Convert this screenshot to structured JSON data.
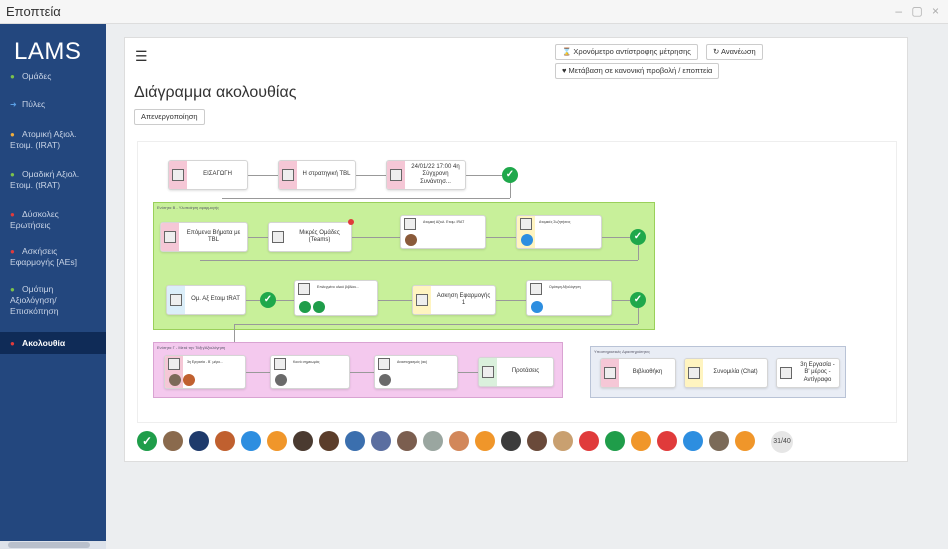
{
  "window": {
    "title": "Εποπτεία",
    "controls": "– ▢ ×"
  },
  "sidebar": {
    "logo": "LAMS",
    "items": [
      {
        "label": "Ομάδες",
        "icon": "group-icon",
        "icon_color": "#7cc24b"
      },
      {
        "label": "Πύλες",
        "icon": "sign-in-icon",
        "icon_color": "#5aa0e6"
      },
      {
        "label": "Ατομική Αξιολ. Ετοιμ. (IRAT)",
        "icon": "user-icon",
        "icon_color": "#f0ad3c"
      },
      {
        "label": "Ομαδική Αξιολ. Ετοιμ. (tRAT)",
        "icon": "users-icon",
        "icon_color": "#7cc24b"
      },
      {
        "label": "Δύσκολες Ερωτήσεις",
        "icon": "alert-icon",
        "icon_color": "#e03b3b"
      },
      {
        "label": "Ασκήσεις Εφαρμογής [AEs]",
        "icon": "cogs-icon",
        "icon_color": "#e03b3b"
      },
      {
        "label": "Ομότιμη Αξιολόγηση/ Επισκόπηση",
        "icon": "users-icon",
        "icon_color": "#7cc24b"
      },
      {
        "label": "Ακολουθία",
        "icon": "sequence-icon",
        "icon_color": "#e03b3b",
        "active": true
      }
    ]
  },
  "toolbar": {
    "timer_label": "⌛ Χρονόμετρο αντίστροφης μέτρησης",
    "refresh_label": "↻ Ανανέωση",
    "switch_view_label": "♥ Μετάβαση σε κανονική προβολή / εποπτεία"
  },
  "page_title": "Διάγραμμα ακολουθίας",
  "deactivate_label": "Απενεργοποίηση",
  "sequence": {
    "top_row": [
      {
        "label": "ΕΙΣΑΓΩΓΗ",
        "strip_color": "#f5c7d6"
      },
      {
        "label": "Η στρατηγική TBL",
        "strip_color": "#f5c7d6"
      },
      {
        "label": "24/01/22 17:00 4η Σύγχρονη Συνάντησ...",
        "strip_color": "#f5c7d6"
      }
    ],
    "zone_b": {
      "label": "Ενότητα Β - Υλοποίηση εφαρμογής",
      "color": "#c8f09a",
      "row1": [
        {
          "label": "Επόμενα Βήματα με TBL",
          "strip_color": "#f5c7d6"
        },
        {
          "label": "Μικρές Ομάδες (Teams)",
          "strip_color": "#ffffff"
        },
        {
          "label": "Ατομική Αξιολ. Ετοιμ. IRAT",
          "strip_color": "#ffffff"
        },
        {
          "label": "Ατομικές Συζητήσεις",
          "strip_color": "#fff4c0"
        }
      ],
      "row2": [
        {
          "label": "Ομ. Αξ Ετοιμ tRAT",
          "strip_color": "#dbeef9"
        },
        {
          "label": "Επιλεγμένο υλικό βιβλίου...",
          "strip_color": "#ffffff"
        },
        {
          "label": "Ασκηση Εφαρμογής 1",
          "strip_color": "#fff4c0"
        },
        {
          "label": "Ομότιμη Αξιολόγηση",
          "strip_color": "#ffffff"
        }
      ]
    },
    "zone_c": {
      "label": "Ενότητα Γ - Μετά την Τάξη/Αξιολόγηση",
      "color": "#f4c9ee",
      "row": [
        {
          "label": "3η Εργασία - Β΄ μέρο...",
          "strip_color": "#f5c7d6"
        },
        {
          "label": "Κοινό σημειωμάς",
          "strip_color": "#ffffff"
        },
        {
          "label": "Αναστοχασμός (ακ)",
          "strip_color": "#ffffff"
        },
        {
          "label": "Προτάσεις",
          "strip_color": "#daf0dc"
        }
      ]
    },
    "support": {
      "label": "Υποστηρικτικές Δραστηριότητες",
      "color": "#e9edf5",
      "items": [
        {
          "label": "Βιβλιοθήκη",
          "strip_color": "#f5c7d6"
        },
        {
          "label": "Συνομιλία (Chat)",
          "strip_color": "#fff4c0"
        },
        {
          "label": "3η Εργασία - Β' μέρος - Αντίγραφο",
          "strip_color": "#ffffff"
        }
      ]
    }
  },
  "learners": {
    "count_label": "31/40",
    "avatar_colors": [
      "#1f9d4a",
      "#8a6a4d",
      "#1e3a6b",
      "#c0602f",
      "#2d8ee0",
      "#f0962a",
      "#4a3a30",
      "#5b3d2a",
      "#3b6fae",
      "#5b6ea0",
      "#7b5e4f",
      "#9aa6a0",
      "#d2875a",
      "#f0962a",
      "#3b3b3b",
      "#6a4a3a",
      "#c9a070",
      "#e03b3b",
      "#1f9d4a",
      "#f0962a",
      "#e03b3b",
      "#2d8ee0",
      "#7b6a58",
      "#f0962a"
    ]
  }
}
